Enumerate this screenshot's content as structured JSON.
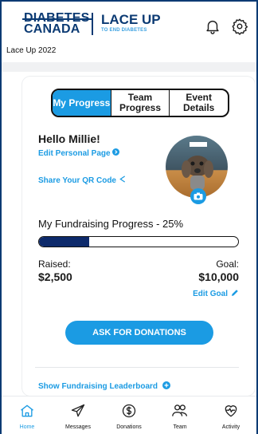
{
  "header": {
    "logo_left": "DIABETES",
    "logo_left_sub": "CANADA",
    "logo_right": "LACE UP",
    "logo_right_sub": "TO END DIABETES"
  },
  "event": {
    "title": "Lace Up 2022"
  },
  "tabs": [
    {
      "label": "My Progress",
      "active": true
    },
    {
      "label": "Team Progress",
      "active": false
    },
    {
      "label": "Event Details",
      "active": false
    }
  ],
  "profile": {
    "greeting": "Hello Millie!",
    "edit_page": "Edit Personal Page",
    "share_qr": "Share Your QR Code"
  },
  "fundraising": {
    "title": "My Fundraising Progress - 25%",
    "progress_fraction": 0.25,
    "raised_label": "Raised:",
    "raised_value": "$2,500",
    "goal_label": "Goal:",
    "goal_value": "$10,000",
    "edit_goal": "Edit Goal"
  },
  "actions": {
    "ask_donations": "ASK FOR DONATIONS",
    "leaderboard": "Show Fundraising Leaderboard"
  },
  "nav": [
    {
      "label": "Home",
      "icon": "home-icon",
      "active": true
    },
    {
      "label": "Messages",
      "icon": "send-icon",
      "active": false
    },
    {
      "label": "Donations",
      "icon": "dollar-icon",
      "active": false
    },
    {
      "label": "Team",
      "icon": "team-icon",
      "active": false
    },
    {
      "label": "Activity",
      "icon": "heart-pulse-icon",
      "active": false
    }
  ],
  "colors": {
    "accent": "#1b9be3",
    "brand": "#0b3a73",
    "progress": "#0d2a6b"
  }
}
